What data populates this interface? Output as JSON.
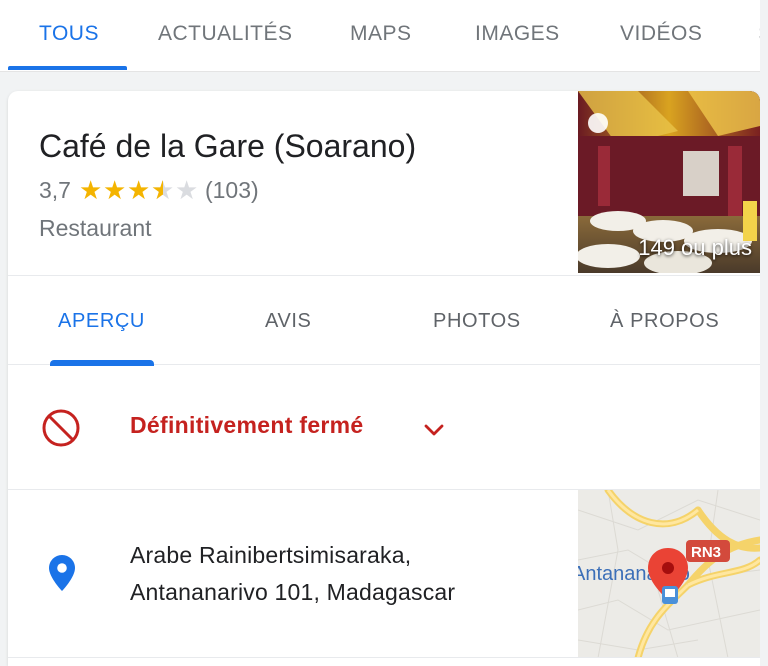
{
  "search_tabs": {
    "items": [
      {
        "label": "TOUS",
        "active": true
      },
      {
        "label": "ACTUALITÉS",
        "active": false
      },
      {
        "label": "MAPS",
        "active": false
      },
      {
        "label": "IMAGES",
        "active": false
      },
      {
        "label": "VIDÉOS",
        "active": false
      },
      {
        "label": "S",
        "active": false
      }
    ]
  },
  "place": {
    "name": "Café de la Gare (Soarano)",
    "rating_value": "3,7",
    "rating_stars": 3.5,
    "review_count": "(103)",
    "type": "Restaurant",
    "photo_count": "149 ou plus"
  },
  "place_tabs": [
    {
      "label": "APERÇU",
      "active": true
    },
    {
      "label": "AVIS",
      "active": false
    },
    {
      "label": "PHOTOS",
      "active": false
    },
    {
      "label": "À PROPOS",
      "active": false
    }
  ],
  "status": {
    "text": "Définitivement fermé",
    "icon": "prohibited-icon",
    "color": "#c5221f"
  },
  "address": {
    "line1": "Arabe Rainibertsimisaraka,",
    "line2": "Antananarivo 101, Madagascar",
    "icon": "location-pin-icon"
  },
  "map": {
    "road_badge": "RN3",
    "place_label": "Antananarivo"
  },
  "colors": {
    "accent": "#1a73e8",
    "closed": "#c5221f",
    "star": "#f4b400"
  }
}
